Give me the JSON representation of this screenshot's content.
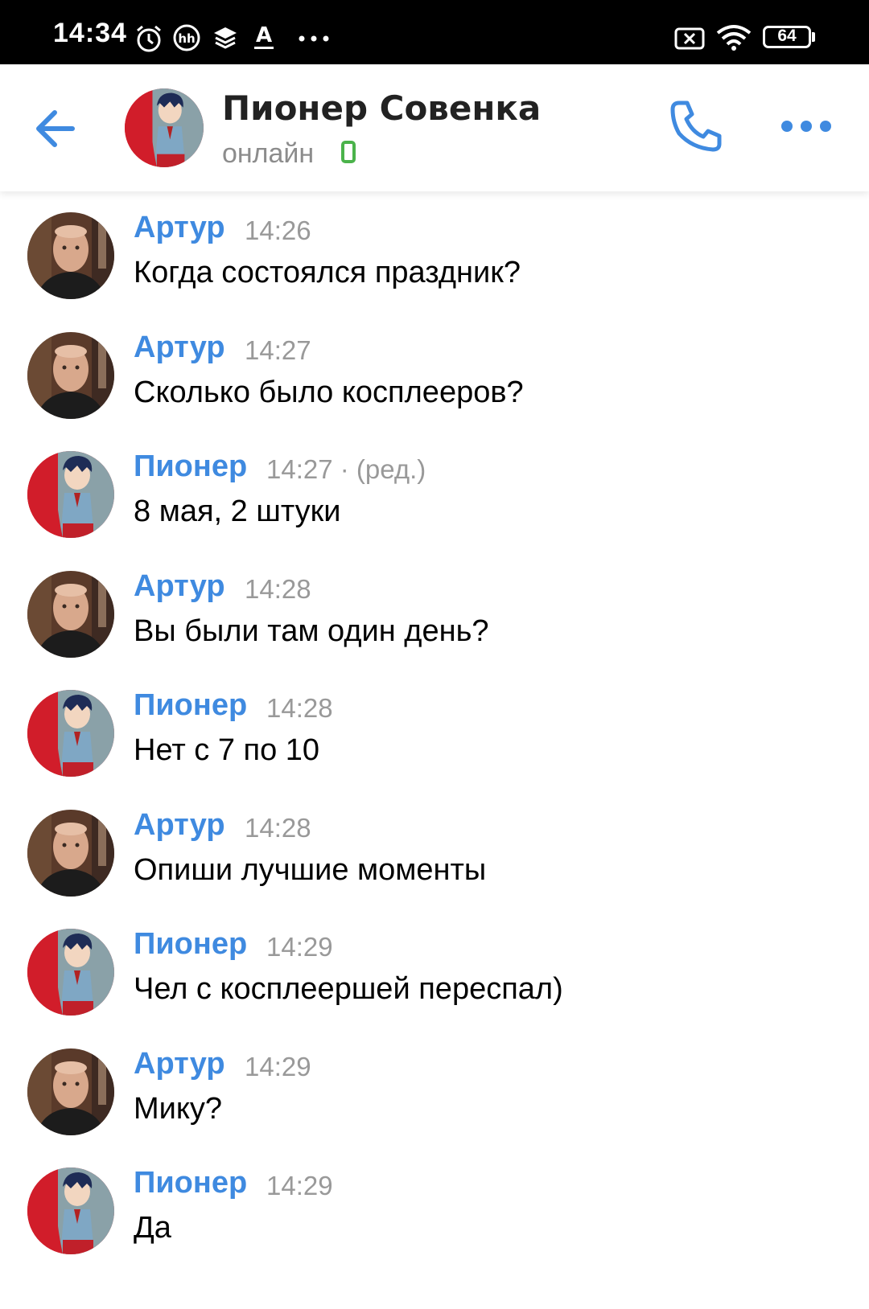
{
  "status_bar": {
    "time": "14:34",
    "battery": "64",
    "icons": [
      "alarm-icon",
      "hh-app-icon",
      "layers-icon",
      "text-a-icon",
      "more-dots-icon",
      "sim-x-icon",
      "wifi-icon",
      "battery-icon"
    ]
  },
  "header": {
    "name": "Пионер Совенка",
    "status": "онлайн",
    "colors": {
      "accent": "#3f8ae0",
      "online": "#4bb34b"
    }
  },
  "messages": [
    {
      "author": "Артур",
      "time": "14:26",
      "text": "Когда состоялся праздник?",
      "avatar": "artur"
    },
    {
      "author": "Артур",
      "time": "14:27",
      "text": "Сколько было косплееров?",
      "avatar": "artur"
    },
    {
      "author": "Пионер",
      "time": "14:27 · (ред.)",
      "text": "8 мая, 2 штуки",
      "avatar": "pioneer"
    },
    {
      "author": "Артур",
      "time": "14:28",
      "text": "Вы были там один день?",
      "avatar": "artur"
    },
    {
      "author": "Пионер",
      "time": "14:28",
      "text": "Нет с 7 по 10",
      "avatar": "pioneer"
    },
    {
      "author": "Артур",
      "time": "14:28",
      "text": "Опиши лучшие моменты",
      "avatar": "artur"
    },
    {
      "author": "Пионер",
      "time": "14:29",
      "text": "Чел с косплеершей переспал)",
      "avatar": "pioneer"
    },
    {
      "author": "Артур",
      "time": "14:29",
      "text": "Мику?",
      "avatar": "artur"
    },
    {
      "author": "Пионер",
      "time": "14:29",
      "text": "Да",
      "avatar": "pioneer"
    }
  ]
}
